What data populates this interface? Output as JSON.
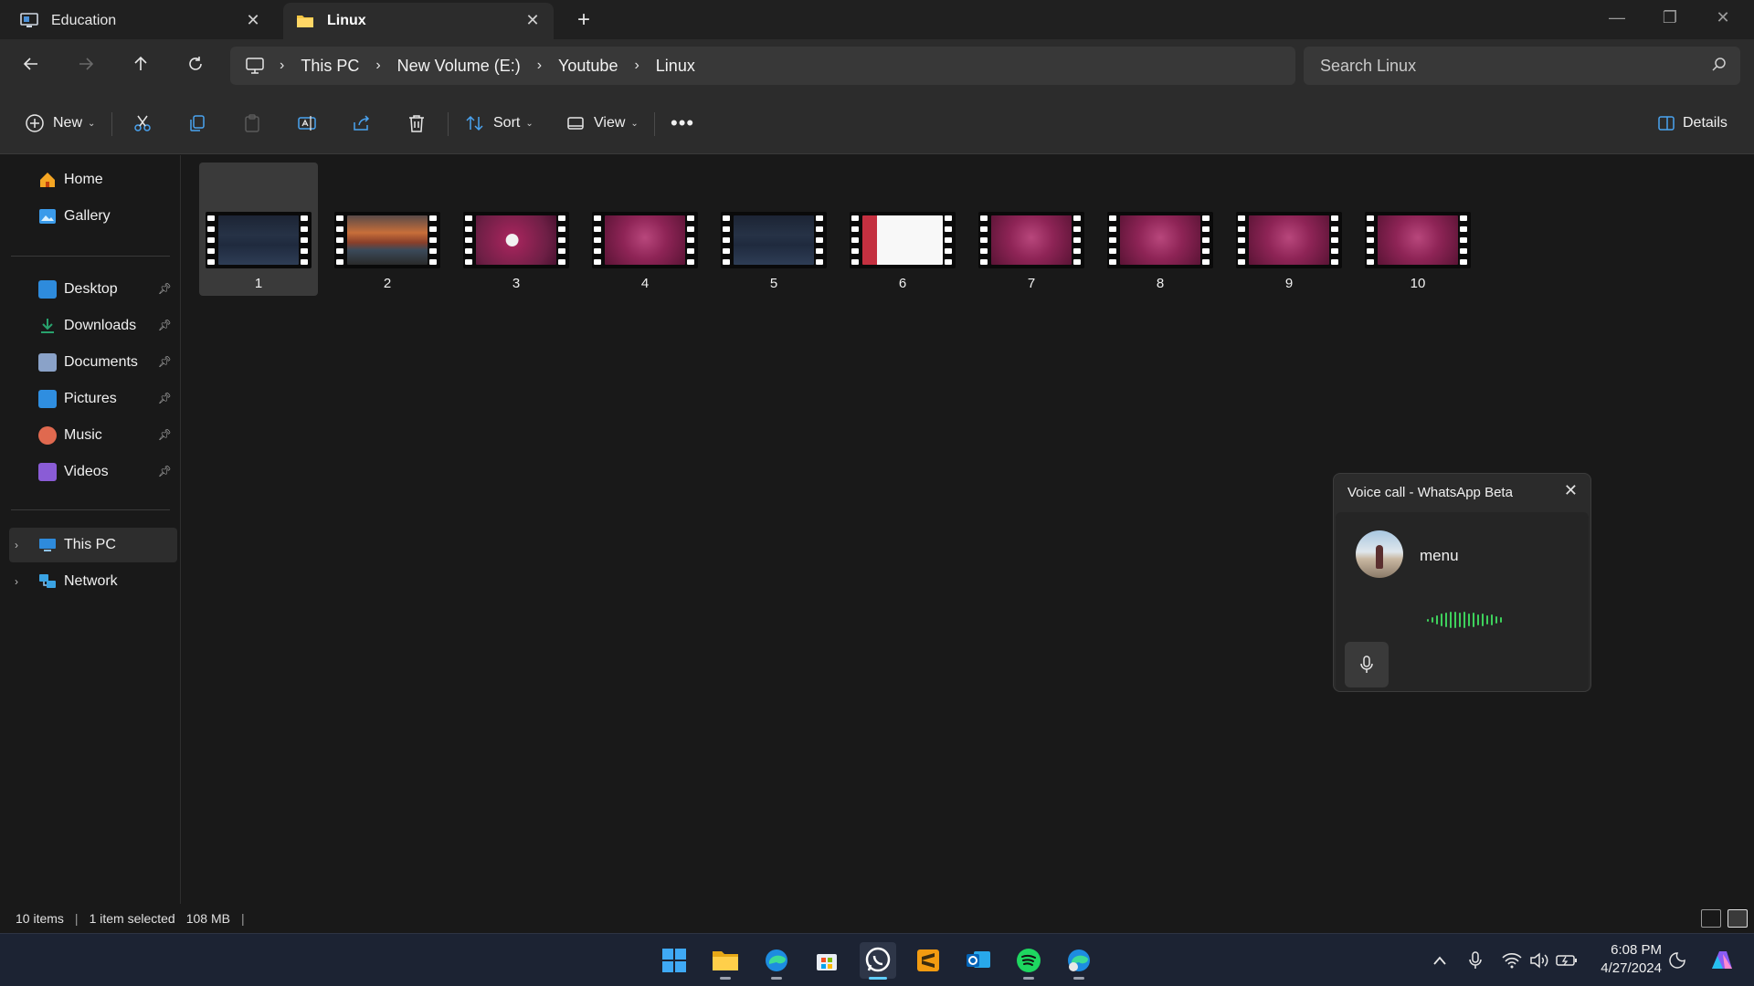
{
  "tabs": [
    {
      "label": "Education",
      "active": false
    },
    {
      "label": "Linux",
      "active": true
    }
  ],
  "address": {
    "crumbs": [
      "This PC",
      "New Volume (E:)",
      "Youtube",
      "Linux"
    ]
  },
  "search": {
    "placeholder": "Search Linux"
  },
  "commandbar": {
    "new_label": "New",
    "sort_label": "Sort",
    "view_label": "View",
    "details_label": "Details"
  },
  "sidebar": {
    "top": [
      {
        "label": "Home",
        "color": "#f5a623"
      },
      {
        "label": "Gallery",
        "color": "#3b9bea"
      }
    ],
    "quick": [
      {
        "label": "Desktop",
        "color": "#2e8bdc"
      },
      {
        "label": "Downloads",
        "color": "#28a26d"
      },
      {
        "label": "Documents",
        "color": "#8aa2c8"
      },
      {
        "label": "Pictures",
        "color": "#2f8ee0"
      },
      {
        "label": "Music",
        "color": "#e0694f"
      },
      {
        "label": "Videos",
        "color": "#8a5cd6"
      }
    ],
    "tree": [
      {
        "label": "This PC",
        "color": "#2e8bdc",
        "selected": true
      },
      {
        "label": "Network",
        "color": "#3aa3e3",
        "selected": false
      }
    ]
  },
  "files": [
    {
      "name": "1",
      "kind": "editor",
      "selected": true
    },
    {
      "name": "2",
      "kind": "landscape",
      "selected": false
    },
    {
      "name": "3",
      "kind": "ubuntu-dialog",
      "selected": false
    },
    {
      "name": "4",
      "kind": "ubuntu",
      "selected": false
    },
    {
      "name": "5",
      "kind": "editor",
      "selected": false
    },
    {
      "name": "6",
      "kind": "document",
      "selected": false
    },
    {
      "name": "7",
      "kind": "ubuntu",
      "selected": false
    },
    {
      "name": "8",
      "kind": "ubuntu",
      "selected": false
    },
    {
      "name": "9",
      "kind": "ubuntu",
      "selected": false
    },
    {
      "name": "10",
      "kind": "ubuntu",
      "selected": false
    }
  ],
  "status": {
    "count": "10 items",
    "selection": "1 item selected",
    "size": "108 MB"
  },
  "call": {
    "title": "Voice call - WhatsApp Beta",
    "contact": "menu"
  },
  "taskbar": {
    "apps": [
      "start-icon",
      "file-explorer-icon",
      "edge-icon",
      "store-icon",
      "whatsapp-icon",
      "sublime-icon",
      "outlook-icon",
      "spotify-icon",
      "edge-beta-icon"
    ]
  },
  "clock": {
    "time": "6:08 PM",
    "date": "4/27/2024"
  }
}
